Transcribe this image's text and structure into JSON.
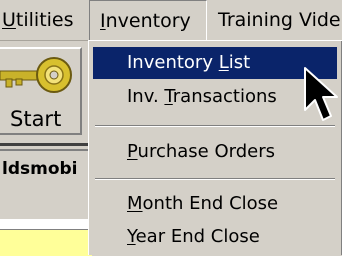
{
  "menubar": {
    "utilities": {
      "pre": "",
      "key": "U",
      "post": "tilities"
    },
    "inventory": {
      "pre": "",
      "key": "I",
      "post": "nventory"
    },
    "training": {
      "pre": "Training Vide",
      "key": "",
      "post": ""
    }
  },
  "background": {
    "start_label": "Start",
    "partial_text": "ldsmobi",
    "field_color": "#ffff99"
  },
  "dropdown": {
    "items": [
      {
        "pre": "Inventory ",
        "key": "L",
        "post": "ist",
        "active": true
      },
      {
        "pre": "Inv. ",
        "key": "T",
        "post": "ransactions",
        "active": false
      },
      {
        "pre": "",
        "key": "P",
        "post": "urchase Orders",
        "active": false
      },
      {
        "pre": "",
        "key": "M",
        "post": "onth End Close",
        "active": false
      },
      {
        "pre": "",
        "key": "Y",
        "post": "ear End Close",
        "active": false
      }
    ]
  },
  "colors": {
    "highlight": "#0a246a",
    "menu_bg": "#d4d0c8"
  },
  "icons": {
    "start_button_icon": "key-icon",
    "pointer": "mouse-cursor-icon"
  }
}
